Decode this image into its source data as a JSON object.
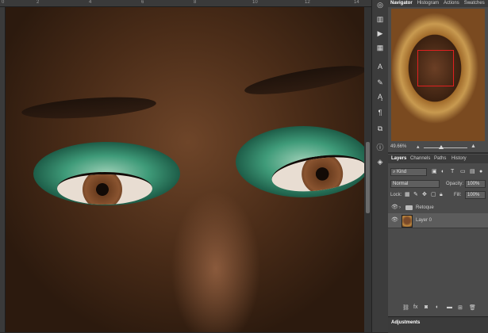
{
  "ruler": {
    "marks": [
      "0",
      "2",
      "4",
      "6",
      "8",
      "10",
      "12",
      "14"
    ]
  },
  "panel_tabs": [
    "Navigator",
    "Histogram",
    "Actions",
    "Swatches"
  ],
  "navigator": {
    "zoom": "49.66%"
  },
  "layers_tabs": [
    "Layers",
    "Channels",
    "Paths",
    "History"
  ],
  "layers": {
    "filter_kind": "Kind",
    "blend_mode": "Normal",
    "opacity_label": "Opacity:",
    "opacity_value": "100%",
    "lock_label": "Lock:",
    "fill_label": "Fill:",
    "fill_value": "100%",
    "items": [
      {
        "name": "Retoque",
        "type": "group"
      },
      {
        "name": "Layer 0",
        "type": "pixel"
      }
    ]
  },
  "footer_icons": [
    "link-icon",
    "fx-icon",
    "mask-icon",
    "adjustment-icon",
    "folder-icon",
    "new-layer-icon",
    "trash-icon"
  ],
  "adjustments": {
    "title": "Adjustments"
  },
  "colors": {
    "accent": "#e02020",
    "panel_bg": "#4b4b4b",
    "dark_bg": "#2b2b2b"
  }
}
